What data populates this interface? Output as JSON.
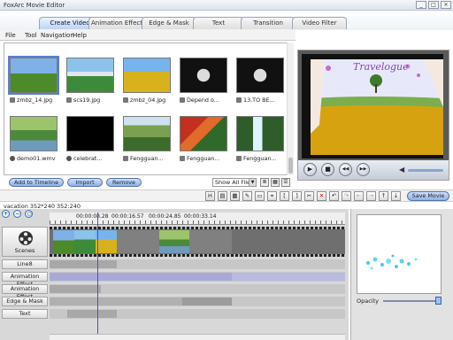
{
  "window": {
    "title": "FoxArc Movie Editor",
    "buttons": [
      "_",
      "□",
      "×"
    ]
  },
  "tabs": [
    "Create Video",
    "Animation Effect",
    "Edge & Mask",
    "Text",
    "Transition",
    "Video Filter"
  ],
  "active_tab": "Create Video",
  "menu": [
    "File",
    "Tool",
    "Navigation",
    "Help"
  ],
  "library": {
    "items": [
      {
        "label": "zmbz_14.jpg",
        "icon": "image-icon"
      },
      {
        "label": "scs19.jpg",
        "icon": "image-icon"
      },
      {
        "label": "zmbz_04.jpg",
        "icon": "image-icon"
      },
      {
        "label": "Depend o...",
        "icon": "audio-icon"
      },
      {
        "label": "13.TO BE...",
        "icon": "audio-icon"
      },
      {
        "label": "demo01.wmv",
        "icon": "video-icon"
      },
      {
        "label": "celebrat...",
        "icon": "video-icon"
      },
      {
        "label": "Fengguan...",
        "icon": "image-icon"
      },
      {
        "label": "Fengguan...",
        "icon": "image-icon"
      },
      {
        "label": "Fengguan...",
        "icon": "image-icon"
      }
    ],
    "buttons": {
      "add": "Add to Timeline",
      "import": "Import",
      "remove": "Remove"
    },
    "filter": "Show All Files"
  },
  "preview": {
    "overlay_title": "Travelogue"
  },
  "player": {
    "play": "▶",
    "stop": "■",
    "prev": "◀◀",
    "next": "▶▶",
    "volume_icon": "speaker-icon"
  },
  "toolbar": {
    "save_label": "Save Movie",
    "tools": [
      "H",
      "▤",
      "▦",
      "✎",
      "▭",
      "⌖",
      "[",
      "]",
      "✂",
      "✕",
      "↶",
      "↷",
      "←",
      "→",
      "↑",
      "↓"
    ]
  },
  "status": {
    "text": "vacation 352*240 352:240"
  },
  "timeline": {
    "times": [
      "00:00:08.28",
      "00:00:16.57",
      "00:00:24.85",
      "00:00:33.14"
    ],
    "tracks": {
      "scenes": "Scenes",
      "line": "Line8",
      "anim1": "Animation Effect",
      "anim2": "Animation Effect",
      "edge": "Edge & Mask",
      "text": "Text"
    },
    "zoom": [
      "+",
      "−",
      "○"
    ]
  },
  "opacity": {
    "label": "Opacity",
    "value": 1.0
  },
  "colors": {
    "accent": "#8fb1e6",
    "tab_active": "#bcd4f3",
    "playhead": "#3d55d6",
    "track_fill": "#a9a9d9"
  }
}
